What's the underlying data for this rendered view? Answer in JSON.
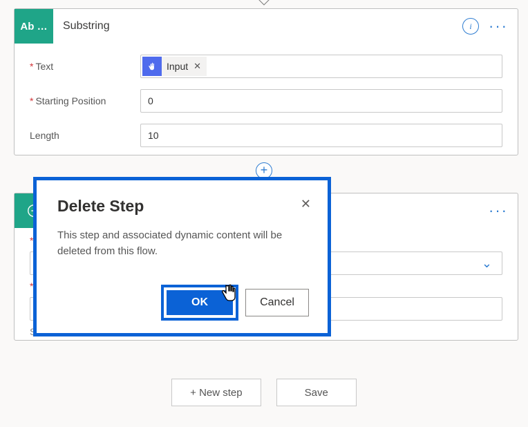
{
  "card1": {
    "icon_label": "Ab …",
    "title": "Substring",
    "fields": {
      "text": {
        "label": "Text",
        "required": true,
        "token": {
          "name": "Input"
        }
      },
      "start": {
        "label": "Starting Position",
        "required": true,
        "value": "0"
      },
      "length": {
        "label": "Length",
        "required": false,
        "value": "10"
      }
    }
  },
  "modal": {
    "title": "Delete Step",
    "message": "This step and associated dynamic content will be deleted from this flow.",
    "ok": "OK",
    "cancel": "Cancel"
  },
  "footer": {
    "new_step": "+ New step",
    "save": "Save"
  }
}
